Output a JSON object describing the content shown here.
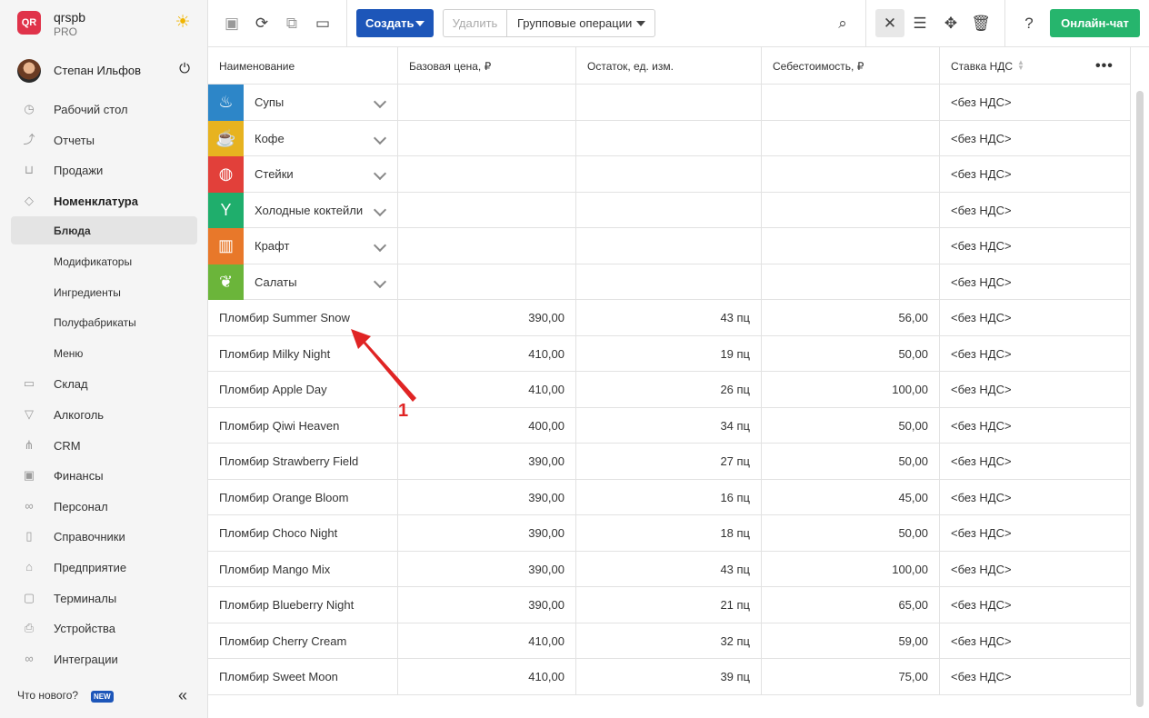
{
  "brand": {
    "logo": "QR",
    "name": "qrspb",
    "plan": "PRO",
    "theme_icon": "sun-icon"
  },
  "user": {
    "name": "Степан Ильфов"
  },
  "nav": [
    {
      "label": "Рабочий стол",
      "icon": "dashboard-icon",
      "glyph": "◷",
      "bold": false,
      "sub": false,
      "active": false
    },
    {
      "label": "Отчеты",
      "icon": "chart-icon",
      "glyph": "⤴",
      "bold": false,
      "sub": false,
      "active": false
    },
    {
      "label": "Продажи",
      "icon": "basket-icon",
      "glyph": "⊔",
      "bold": false,
      "sub": false,
      "active": false
    },
    {
      "label": "Номенклатура",
      "icon": "tag-icon",
      "glyph": "◇",
      "bold": true,
      "sub": false,
      "active": false
    },
    {
      "label": "Блюда",
      "icon": "",
      "glyph": "",
      "bold": false,
      "sub": true,
      "active": true
    },
    {
      "label": "Модификаторы",
      "icon": "",
      "glyph": "",
      "bold": false,
      "sub": true,
      "active": false
    },
    {
      "label": "Ингредиенты",
      "icon": "",
      "glyph": "",
      "bold": false,
      "sub": true,
      "active": false
    },
    {
      "label": "Полуфабрикаты",
      "icon": "",
      "glyph": "",
      "bold": false,
      "sub": true,
      "active": false
    },
    {
      "label": "Меню",
      "icon": "",
      "glyph": "",
      "bold": false,
      "sub": true,
      "active": false
    },
    {
      "label": "Склад",
      "icon": "warehouse-icon",
      "glyph": "▭",
      "bold": false,
      "sub": false,
      "active": false
    },
    {
      "label": "Алкоголь",
      "icon": "cocktail-icon",
      "glyph": "▽",
      "bold": false,
      "sub": false,
      "active": false
    },
    {
      "label": "CRM",
      "icon": "crm-icon",
      "glyph": "⋔",
      "bold": false,
      "sub": false,
      "active": false
    },
    {
      "label": "Финансы",
      "icon": "wallet-icon",
      "glyph": "▣",
      "bold": false,
      "sub": false,
      "active": false
    },
    {
      "label": "Персонал",
      "icon": "people-icon",
      "glyph": "∞",
      "bold": false,
      "sub": false,
      "active": false
    },
    {
      "label": "Справочники",
      "icon": "book-icon",
      "glyph": "▯",
      "bold": false,
      "sub": false,
      "active": false
    },
    {
      "label": "Предприятие",
      "icon": "store-icon",
      "glyph": "⌂",
      "bold": false,
      "sub": false,
      "active": false
    },
    {
      "label": "Терминалы",
      "icon": "terminal-icon",
      "glyph": "▢",
      "bold": false,
      "sub": false,
      "active": false
    },
    {
      "label": "Устройства",
      "icon": "printer-icon",
      "glyph": "⎙",
      "bold": false,
      "sub": false,
      "active": false
    },
    {
      "label": "Интеграции",
      "icon": "link-icon",
      "glyph": "∞",
      "bold": false,
      "sub": false,
      "active": false
    }
  ],
  "footer": {
    "whats_new": "Что нового?",
    "badge": "NEW"
  },
  "toolbar": {
    "create": "Создать",
    "delete": "Удалить",
    "group": "Групповые операции",
    "chat": "Онлайн-чат"
  },
  "table": {
    "columns": [
      "Наименование",
      "Базовая цена, ₽",
      "Остаток, ед. изм.",
      "Себестоимость, ₽",
      "Ставка НДС"
    ],
    "categories": [
      {
        "name": "Супы",
        "color": "#2d86c8",
        "icon": "soup-icon",
        "glyph": "♨",
        "vat": "<без НДС>"
      },
      {
        "name": "Кофе",
        "color": "#e7b320",
        "icon": "coffee-icon",
        "glyph": "☕",
        "vat": "<без НДС>"
      },
      {
        "name": "Стейки",
        "color": "#e2403a",
        "icon": "steak-icon",
        "glyph": "◍",
        "vat": "<без НДС>"
      },
      {
        "name": "Холодные коктейли",
        "color": "#1fae6c",
        "icon": "cocktail-icon",
        "glyph": "Y",
        "vat": "<без НДС>"
      },
      {
        "name": "Крафт",
        "color": "#e8782a",
        "icon": "beer-icon",
        "glyph": "▥",
        "vat": "<без НДС>"
      },
      {
        "name": "Салаты",
        "color": "#6bb53a",
        "icon": "salad-icon",
        "glyph": "❦",
        "vat": "<без НДС>"
      }
    ],
    "items": [
      {
        "name": "Пломбир Summer Snow",
        "price": "390,00",
        "stock": "43 пц",
        "cost": "56,00",
        "vat": "<без НДС>"
      },
      {
        "name": "Пломбир Milky Night",
        "price": "410,00",
        "stock": "19 пц",
        "cost": "50,00",
        "vat": "<без НДС>"
      },
      {
        "name": "Пломбир Apple Day",
        "price": "410,00",
        "stock": "26 пц",
        "cost": "100,00",
        "vat": "<без НДС>"
      },
      {
        "name": "Пломбир Qiwi Heaven",
        "price": "400,00",
        "stock": "34 пц",
        "cost": "50,00",
        "vat": "<без НДС>"
      },
      {
        "name": "Пломбир Strawberry Field",
        "price": "390,00",
        "stock": "27 пц",
        "cost": "50,00",
        "vat": "<без НДС>"
      },
      {
        "name": "Пломбир Orange Bloom",
        "price": "390,00",
        "stock": "16 пц",
        "cost": "45,00",
        "vat": "<без НДС>"
      },
      {
        "name": "Пломбир Choco Night",
        "price": "390,00",
        "stock": "18 пц",
        "cost": "50,00",
        "vat": "<без НДС>"
      },
      {
        "name": "Пломбир Mango Mix",
        "price": "390,00",
        "stock": "43 пц",
        "cost": "100,00",
        "vat": "<без НДС>"
      },
      {
        "name": "Пломбир Blueberry Night",
        "price": "390,00",
        "stock": "21 пц",
        "cost": "65,00",
        "vat": "<без НДС>"
      },
      {
        "name": "Пломбир Cherry Cream",
        "price": "410,00",
        "stock": "32 пц",
        "cost": "59,00",
        "vat": "<без НДС>"
      },
      {
        "name": "Пломбир Sweet Moon",
        "price": "410,00",
        "stock": "39 пц",
        "cost": "75,00",
        "vat": "<без НДС>"
      }
    ]
  },
  "annotation": {
    "label": "1",
    "color": "#e02424"
  },
  "colors": {
    "primary": "#1d56b9",
    "chat": "#26b56d",
    "sidebar_bg": "#f5f5f5"
  }
}
